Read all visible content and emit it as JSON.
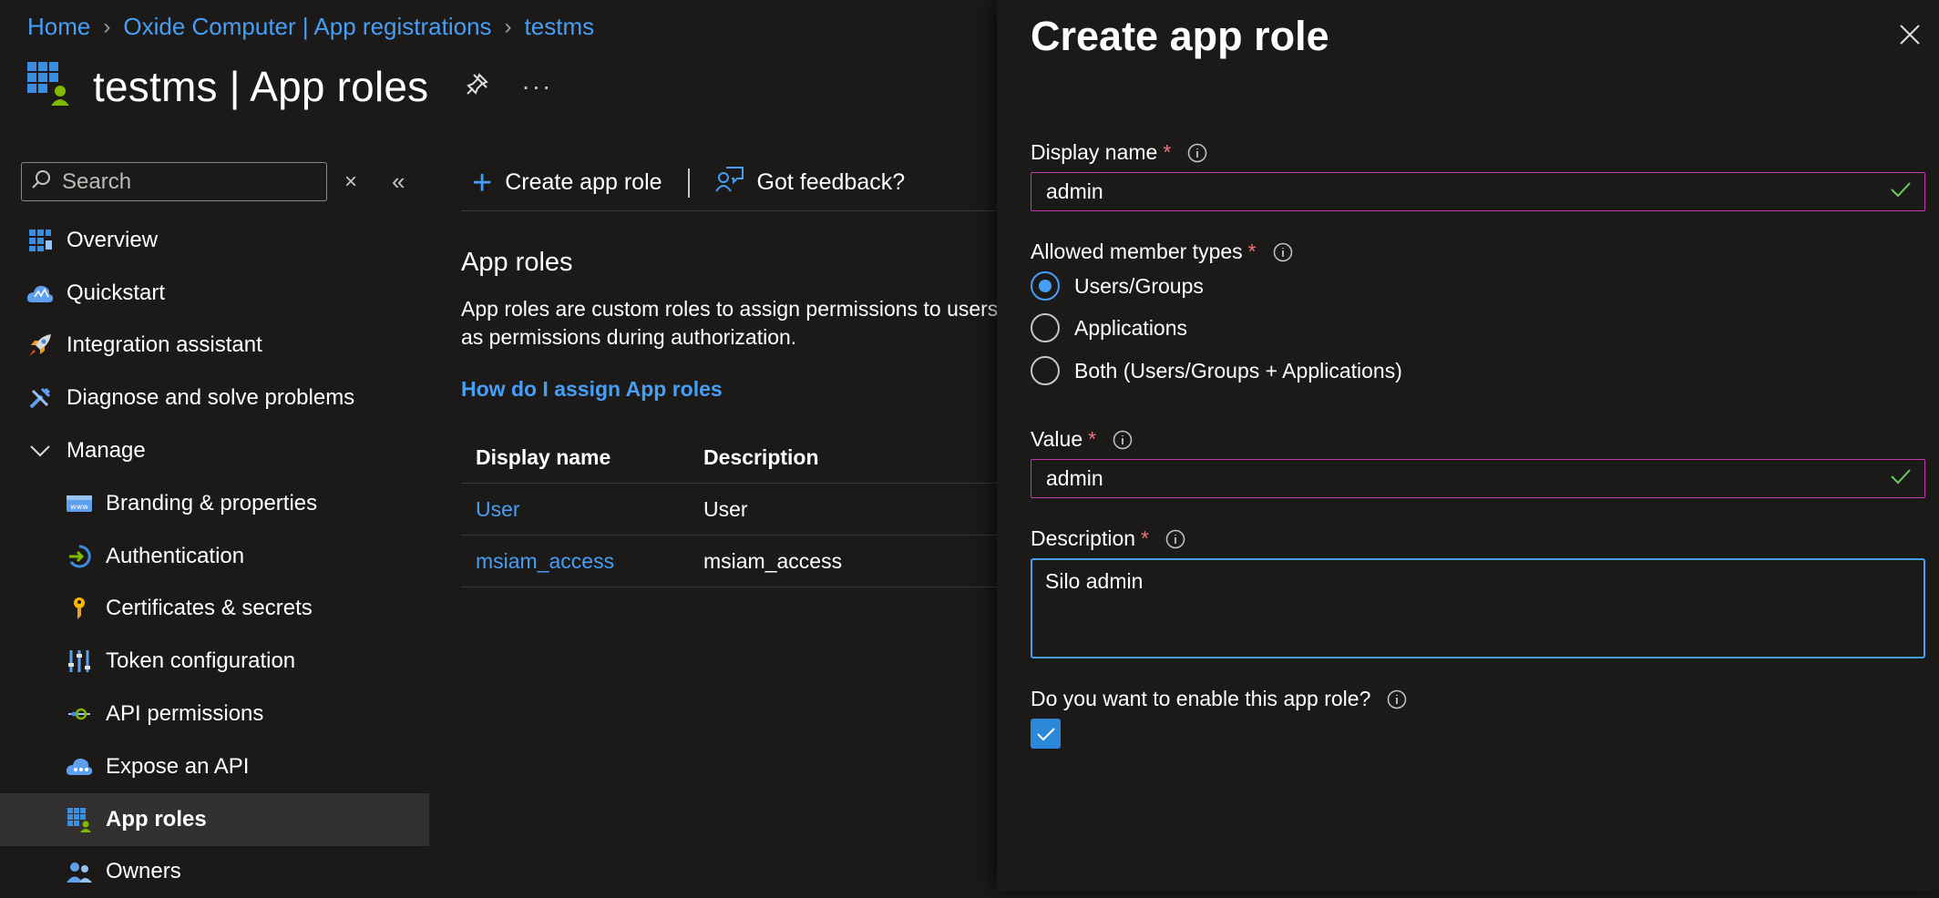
{
  "breadcrumb": {
    "home": "Home",
    "tenant": "Oxide Computer | App registrations",
    "current": "testms"
  },
  "header": {
    "title": "testms | App roles",
    "more": "···"
  },
  "search": {
    "placeholder": "Search"
  },
  "nav": {
    "overview": "Overview",
    "quickstart": "Quickstart",
    "integration": "Integration assistant",
    "diagnose": "Diagnose and solve problems",
    "manage": "Manage",
    "branding": "Branding & properties",
    "authentication": "Authentication",
    "certificates": "Certificates & secrets",
    "token": "Token configuration",
    "api_permissions": "API permissions",
    "expose_api": "Expose an API",
    "app_roles": "App roles",
    "owners": "Owners"
  },
  "command_bar": {
    "create_role": "Create app role",
    "feedback": "Got feedback?"
  },
  "content": {
    "section_title": "App roles",
    "description_line1": "App roles are custom roles to assign permissions to users",
    "description_line2": "as permissions during authorization.",
    "assign_link": "How do I assign App roles"
  },
  "table": {
    "headers": [
      "Display name",
      "Description"
    ],
    "rows": [
      {
        "name": "User",
        "description": "User"
      },
      {
        "name": "msiam_access",
        "description": "msiam_access"
      }
    ]
  },
  "panel": {
    "title": "Create app role",
    "display_name": {
      "label": "Display name",
      "value": "admin"
    },
    "member_types": {
      "label": "Allowed member types",
      "options": [
        "Users/Groups",
        "Applications",
        "Both (Users/Groups + Applications)"
      ],
      "selected": "Users/Groups"
    },
    "value_field": {
      "label": "Value",
      "value": "admin"
    },
    "description": {
      "label": "Description",
      "value": "Silo admin"
    },
    "enable": {
      "label": "Do you want to enable this app role?",
      "checked": true
    },
    "required_mark": "*"
  },
  "colors": {
    "accent": "#479ef5",
    "required": "#f1707b",
    "valid": "#6ccb5f",
    "field_border": "#c239b3",
    "background": "#1b1a19"
  }
}
